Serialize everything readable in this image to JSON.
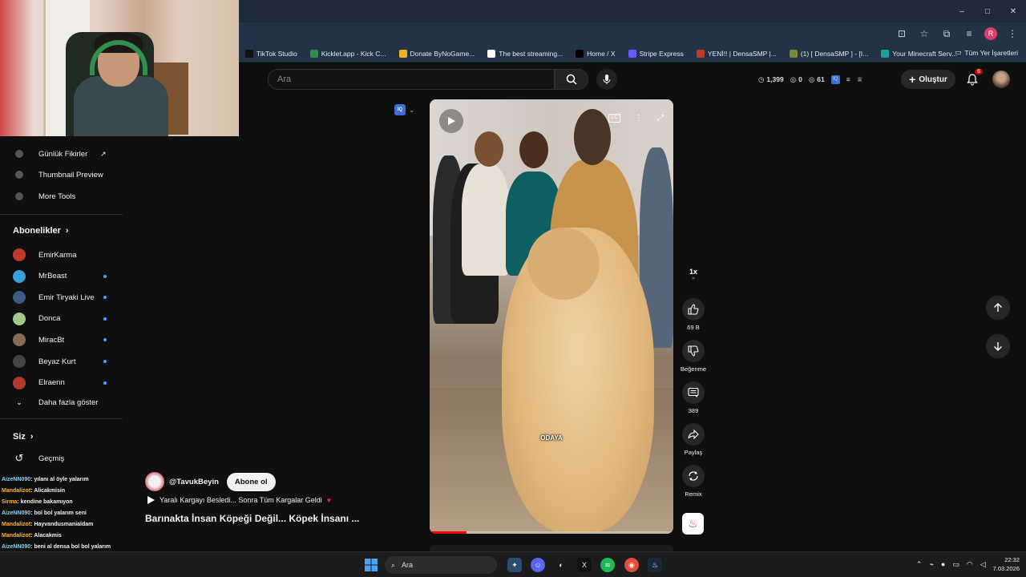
{
  "browser": {
    "bookmarks": [
      {
        "label": "TikTok Studio",
        "color": "#111111"
      },
      {
        "label": "Kicklet.app - Kick C...",
        "color": "#2f8a4c"
      },
      {
        "label": "Donate ByNoGame...",
        "color": "#f0b429"
      },
      {
        "label": "The best streaming...",
        "color": "#ffffff"
      },
      {
        "label": "Home / X",
        "color": "#000000"
      },
      {
        "label": "Stripe Express",
        "color": "#635bff"
      },
      {
        "label": "YENİ!! | DensaSMP |...",
        "color": "#c0392b"
      },
      {
        "label": "(1) [ DensaSMP ] - [I...",
        "color": "#7a8a33"
      },
      {
        "label": "Your Minecraft Serv...",
        "color": "#1aa39c"
      }
    ],
    "all_bookmarks": "Tüm Yer İşaretleri",
    "profile_initial": "R",
    "window_controls": [
      "–",
      "□",
      "✕"
    ]
  },
  "header": {
    "search_placeholder": "Ara",
    "stats": {
      "views": "1,399",
      "a": "0",
      "b": "61"
    },
    "create_label": "Oluştur",
    "notif_count": "6"
  },
  "sidebar": {
    "tools": [
      "Günlük Fikirler",
      "Thumbnail Preview",
      "More Tools"
    ],
    "subscriptions_title": "Abonelikler",
    "subscriptions": [
      {
        "name": "EmirKarma",
        "color": "#c0392b",
        "new": false
      },
      {
        "name": "MrBeast",
        "color": "#3aa0d8",
        "new": true
      },
      {
        "name": "Emir Tiryaki Live",
        "color": "#3d5a80",
        "new": true
      },
      {
        "name": "Donca",
        "color": "#a3c98a",
        "new": true
      },
      {
        "name": "MiracBt",
        "color": "#8a6b55",
        "new": true
      },
      {
        "name": "Beyaz Kurt",
        "color": "#444444",
        "new": true
      },
      {
        "name": "Elraenn",
        "color": "#b03a2e",
        "new": true
      }
    ],
    "show_more": "Daha fazla göster",
    "you_title": "Siz",
    "history": "Geçmiş"
  },
  "chat": [
    {
      "user": "AizeNN090",
      "msg": ": yılanı al öyle yalarım",
      "cls": "u1"
    },
    {
      "user": "Mandalizot",
      "msg": ": Alicakmisin",
      "cls": "u2"
    },
    {
      "user": "Sirma",
      "msg": ": kendine bakamıyon",
      "cls": "u2"
    },
    {
      "user": "AizeNN090",
      "msg": ": bol bol yalarım seni",
      "cls": "u1"
    },
    {
      "user": "Mandalizot",
      "msg": ": Hayvandusmanialdam",
      "cls": "u2"
    },
    {
      "user": "Mandalizot",
      "msg": ": Alacakmis",
      "cls": "u2"
    },
    {
      "user": "AizeNN090",
      "msg": ": beni al densa bol bol yalarım",
      "cls": "u1"
    },
    {
      "user": "Mandalizot",
      "msg": ": Oha",
      "cls": "u2"
    },
    {
      "user": "Mandalizot",
      "msg": ": Nediyo",
      "cls": "u2"
    }
  ],
  "video": {
    "caption": "ODAYA",
    "progress": 0.15,
    "channel": "@TavukBeyin",
    "subscribe": "Abone ol",
    "related": "Yaralı Kargayı Besledi... Sonra Tüm Kargalar Geldi",
    "title": "Barınakta İnsan Köpeği Değil... Köpek İnsanı ..."
  },
  "actions": {
    "speed": "1x",
    "likes": "69 B",
    "dislike": "Beğenme",
    "comments": "389",
    "share": "Paylaş",
    "remix": "Remix"
  },
  "taskbar": {
    "search": "Ara",
    "time": "22:32",
    "date": "7.03.2026"
  }
}
